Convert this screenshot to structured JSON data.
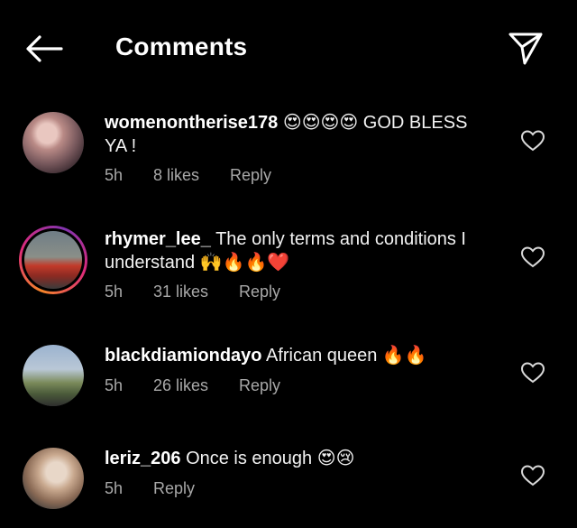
{
  "header": {
    "title": "Comments"
  },
  "comments": [
    {
      "username": "womenontherise178",
      "text": "😍😍😍😍 GOD BLESS YA !",
      "text_line1": " 😍😍😍😍 GOD BLESS",
      "text_line2": "YA !",
      "time": "5h",
      "likes": "8 likes",
      "reply": "Reply"
    },
    {
      "username": "rhymer_lee_",
      "text_line1": " The only terms and conditions I",
      "text_line2": "understand 🙌🔥🔥❤️",
      "time": "5h",
      "likes": "31 likes",
      "reply": "Reply"
    },
    {
      "username": "blackdiamiondayo",
      "text_line1": " African queen 🔥🔥",
      "time": "5h",
      "likes": "26 likes",
      "reply": "Reply"
    },
    {
      "username": "leriz_206",
      "text_line1": " Once is enough 😍😢",
      "time": "5h",
      "reply": "Reply"
    }
  ]
}
